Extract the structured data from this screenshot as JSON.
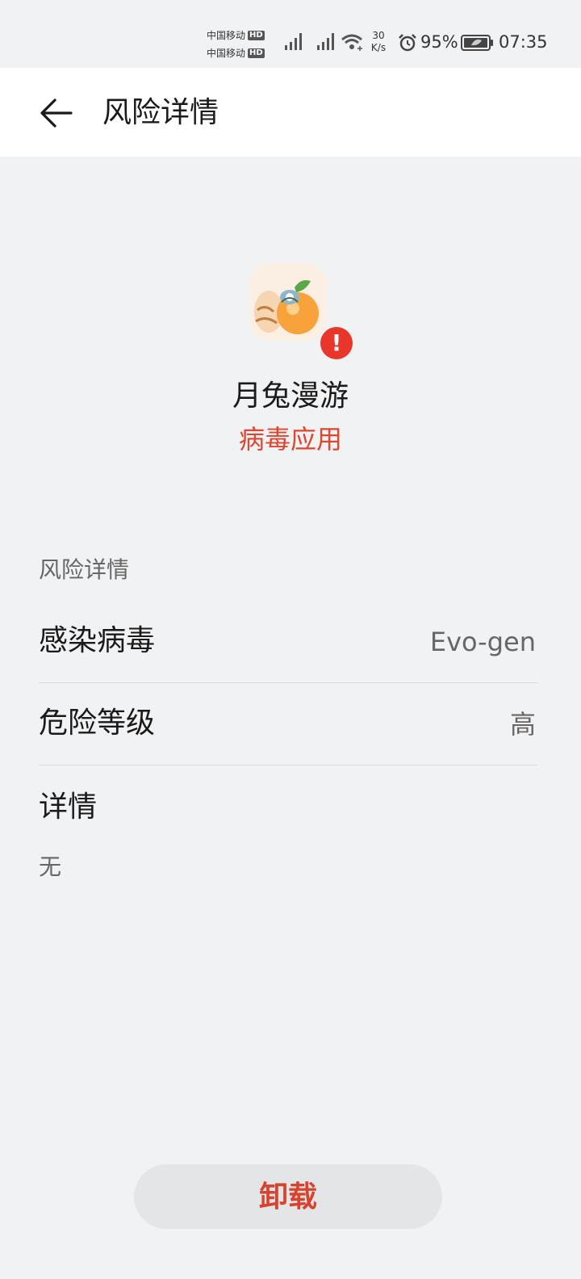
{
  "status_bar": {
    "carriers": [
      {
        "name": "中国移动",
        "badge": "HD"
      },
      {
        "name": "中国移动",
        "badge": "HD"
      }
    ],
    "net_speed_value": "30",
    "net_speed_unit": "K/s",
    "battery_percent": "95%",
    "time": "07:35"
  },
  "header": {
    "title": "风险详情",
    "back_icon": "arrow-left-icon"
  },
  "app": {
    "name": "月兔漫游",
    "risk_label": "病毒应用",
    "warning_glyph": "!",
    "risk_color": "#e0452f"
  },
  "details": {
    "section_title": "风险详情",
    "rows": [
      {
        "label": "感染病毒",
        "value": "Evo-gen"
      },
      {
        "label": "危险等级",
        "value": "高"
      }
    ],
    "detail_label": "详情",
    "detail_text": "无"
  },
  "actions": {
    "uninstall_label": "卸载"
  }
}
